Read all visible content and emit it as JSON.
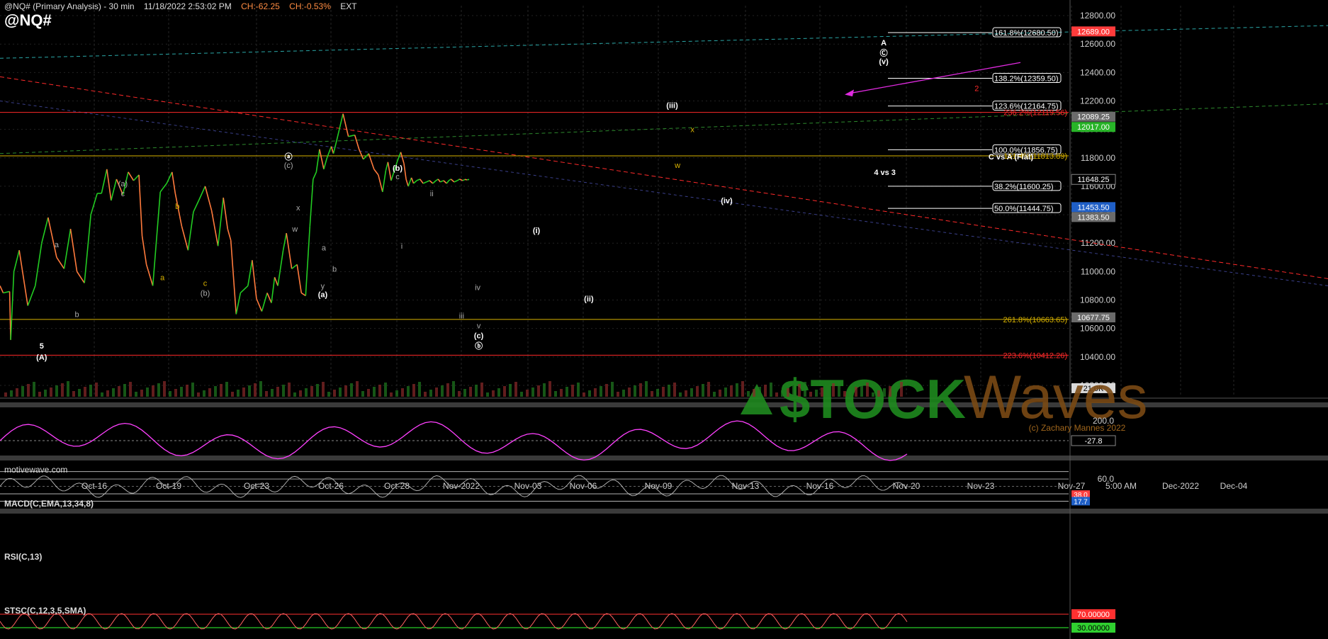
{
  "header": {
    "symbol_line": "@NQ# (Primary Analysis) - 30 min",
    "datetime": "11/18/2022 2:53:02 PM",
    "change": "CH:-62.25",
    "change_pct": "CH:-0.53%",
    "session": "EXT",
    "symbol": "@NQ#"
  },
  "footer": {
    "source": "motivewave.com"
  },
  "colors": {
    "background": "#000000",
    "up": "#22cc22",
    "down": "#ff7a3c",
    "fib_line": "#ffffff",
    "red_line": "#ff2a2a",
    "yellow_line": "#d9b300",
    "teal_line": "#2aa6a6",
    "magenta": "#e02ae0"
  },
  "chart_data": [
    {
      "type": "line",
      "title": "",
      "y_axis": {
        "ticks": [
          "12800.00",
          "12600.00",
          "12400.00",
          "12200.00",
          "12000.00",
          "11800.00",
          "11600.00",
          "11400.00",
          "11200.00",
          "11000.00",
          "10800.00",
          "10600.00",
          "10400.00",
          "10200.00"
        ],
        "ylim": [
          10120,
          12870
        ]
      },
      "x_axis": {
        "ticks": [
          "Oct-16",
          "Oct-19",
          "Oct-23",
          "Oct-26",
          "Oct-28",
          "Nov-2022",
          "Nov-03",
          "Nov-06",
          "Nov-09",
          "Nov-13",
          "Nov-16",
          "Nov-20",
          "Nov-23",
          "Nov-27",
          "5:00 AM",
          "Dec-2022",
          "Dec-04"
        ]
      },
      "price_path": {
        "x": [
          0,
          0.3,
          0.9,
          1.0,
          1.3,
          1.8,
          2.6,
          3.3,
          3.9,
          4.5,
          5.3,
          6.0,
          6.6,
          7.2,
          7.9,
          8.5,
          9.1,
          9.5,
          10.0,
          10.4,
          10.9,
          11.5,
          12.0,
          12.5,
          13.0,
          13.3,
          13.7,
          14.3,
          15.0,
          15.6,
          16.1,
          16.4,
          17.0,
          17.6,
          18.1,
          18.6,
          19.2,
          19.8,
          20.4,
          20.9,
          21.3,
          21.6,
          22.1,
          22.5,
          23.2,
          23.6,
          24.0,
          24.5,
          25.0,
          25.4,
          25.7,
          26.0,
          26.5,
          26.8,
          27.3,
          27.8,
          28.2,
          28.6,
          29.0,
          29.3,
          29.6,
          29.9,
          30.3,
          30.6,
          31.0,
          31.2,
          31.5,
          32.1,
          32.6,
          33.2,
          33.6,
          34.0,
          34.5,
          35.0,
          35.4,
          35.8,
          36.1,
          36.3,
          36.6,
          36.9,
          37.2,
          37.5,
          37.8,
          38.0,
          38.2,
          38.5,
          38.7,
          39.0,
          39.3,
          39.6,
          39.9,
          40.2,
          40.5,
          40.8,
          41.0,
          41.2,
          41.5,
          41.8,
          42.0,
          42.2,
          42.5,
          42.8,
          43.0,
          43.3,
          43.5,
          43.7,
          43.9
        ],
        "y": [
          10900,
          10850,
          10860,
          10520,
          11000,
          11150,
          10760,
          10900,
          11200,
          11380,
          11100,
          11020,
          11300,
          11000,
          10920,
          11400,
          11550,
          11550,
          11720,
          11500,
          11650,
          11540,
          11700,
          11640,
          11680,
          11250,
          11050,
          10900,
          11560,
          11620,
          11700,
          11550,
          11320,
          11150,
          11420,
          11500,
          11600,
          11430,
          11180,
          11520,
          11300,
          11220,
          10700,
          10850,
          10900,
          11080,
          10810,
          10720,
          10850,
          10780,
          10960,
          10900,
          11150,
          11270,
          11020,
          11050,
          10850,
          10830,
          11320,
          11650,
          11700,
          11860,
          11720,
          11800,
          11880,
          11830,
          11920,
          12110,
          11950,
          11960,
          11860,
          11790,
          11830,
          11720,
          11680,
          11560,
          11710,
          11770,
          11640,
          11710,
          11780,
          11840,
          11760,
          11650,
          11600,
          11660,
          11620,
          11640,
          11650,
          11620,
          11630,
          11640,
          11620,
          11640,
          11650,
          11630,
          11640,
          11620,
          11640,
          11650,
          11630,
          11640,
          11650,
          11640,
          11648,
          11645,
          11648
        ]
      },
      "horizontal_levels": [
        {
          "label": "161.8%(12680.50)",
          "value": 12680.5,
          "color": "white"
        },
        {
          "label": "138.2%(12359.50)",
          "value": 12359.5,
          "color": "white"
        },
        {
          "label": "123.6%(12164.75)",
          "value": 12164.75,
          "color": "white"
        },
        {
          "label": "100.0%(11856.75)",
          "value": 11856.75,
          "color": "white"
        },
        {
          "label": "38.2%(11600.25)",
          "value": 11600.25,
          "color": "white"
        },
        {
          "label": "50.0%(11444.75)",
          "value": 11444.75,
          "color": "white"
        },
        {
          "label": "236.2%(12119.56)",
          "value": 12119.56,
          "color": "red"
        },
        {
          "label": "161.4%(11813.89)",
          "value": 11813.89,
          "color": "yellow"
        },
        {
          "label": "261.8%(10663.65)",
          "value": 10663.65,
          "color": "yellow"
        },
        {
          "label": "223.6%(10412.26)",
          "value": 10412.26,
          "color": "red"
        }
      ],
      "price_tags": [
        {
          "label": "12689.00",
          "value": 12689,
          "bg": "#ff3b3b"
        },
        {
          "label": "12089.25",
          "value": 12089.25,
          "bg": "#6b6b6b"
        },
        {
          "label": "12017.00",
          "value": 12017,
          "bg": "#28b428"
        },
        {
          "label": "11648.25",
          "value": 11648.25,
          "bg": "#000000"
        },
        {
          "label": "11453.50",
          "value": 11453.5,
          "bg": "#1f5fc7"
        },
        {
          "label": "11383.50",
          "value": 11383.5,
          "bg": "#6b6b6b"
        },
        {
          "label": "10677.75",
          "value": 10677.75,
          "bg": "#6b6b6b"
        },
        {
          "label": "21.0K",
          "value": 10180,
          "bg": "#d9d9d9"
        }
      ],
      "wave_labels": [
        {
          "t": "(A)",
          "x": 3.9,
          "y": 10380,
          "color": "white"
        },
        {
          "t": "5",
          "x": 3.9,
          "y": 10460,
          "color": "white"
        },
        {
          "t": "a",
          "x": 5.3,
          "y": 11170,
          "color": "#aaaaaa"
        },
        {
          "t": "b",
          "x": 7.2,
          "y": 10680,
          "color": "#aaaaaa"
        },
        {
          "t": "(a)",
          "x": 11.5,
          "y": 11600,
          "color": "#aaaaaa"
        },
        {
          "t": "c",
          "x": 11.5,
          "y": 11530,
          "color": "#aaaaaa"
        },
        {
          "t": "a",
          "x": 15.2,
          "y": 10940,
          "color": "#d9b300"
        },
        {
          "t": "b",
          "x": 16.6,
          "y": 11440,
          "color": "#d9b300"
        },
        {
          "t": "c",
          "x": 19.2,
          "y": 10900,
          "color": "#d9b300"
        },
        {
          "t": "(b)",
          "x": 19.2,
          "y": 10830,
          "color": "#aaaaaa"
        },
        {
          "t": "ⓐ",
          "x": 27.0,
          "y": 11790,
          "color": "white"
        },
        {
          "t": "(c)",
          "x": 27.0,
          "y": 11730,
          "color": "#aaaaaa"
        },
        {
          "t": "x",
          "x": 27.9,
          "y": 11430,
          "color": "#aaaaaa"
        },
        {
          "t": "w",
          "x": 27.6,
          "y": 11280,
          "color": "#aaaaaa"
        },
        {
          "t": "a",
          "x": 30.3,
          "y": 11150,
          "color": "#aaaaaa"
        },
        {
          "t": "y",
          "x": 30.2,
          "y": 10880,
          "color": "#aaaaaa"
        },
        {
          "t": "(a)",
          "x": 30.2,
          "y": 10820,
          "color": "white"
        },
        {
          "t": "b",
          "x": 31.3,
          "y": 11000,
          "color": "#aaaaaa"
        },
        {
          "t": "(b)",
          "x": 37.2,
          "y": 11710,
          "color": "white"
        },
        {
          "t": "c",
          "x": 37.2,
          "y": 11650,
          "color": "#aaaaaa"
        },
        {
          "t": "i",
          "x": 37.6,
          "y": 11160,
          "color": "#aaaaaa"
        },
        {
          "t": "ii",
          "x": 40.4,
          "y": 11530,
          "color": "#aaaaaa"
        },
        {
          "t": "iii",
          "x": 43.2,
          "y": 10670,
          "color": "#aaaaaa"
        },
        {
          "t": "iv",
          "x": 44.7,
          "y": 10870,
          "color": "#aaaaaa"
        },
        {
          "t": "v",
          "x": 44.8,
          "y": 10600,
          "color": "#aaaaaa"
        },
        {
          "t": "(c)",
          "x": 44.8,
          "y": 10530,
          "color": "white"
        },
        {
          "t": "ⓑ",
          "x": 44.8,
          "y": 10460,
          "color": "white"
        },
        {
          "t": "(i)",
          "x": 50.2,
          "y": 11270,
          "color": "white"
        },
        {
          "t": "(ii)",
          "x": 55.1,
          "y": 10790,
          "color": "white"
        },
        {
          "t": "(iii)",
          "x": 62.9,
          "y": 12150,
          "color": "white"
        },
        {
          "t": "x",
          "x": 64.8,
          "y": 11980,
          "color": "#d9b300"
        },
        {
          "t": "w",
          "x": 63.4,
          "y": 11730,
          "color": "#d9b300"
        },
        {
          "t": "(iv)",
          "x": 68.0,
          "y": 11480,
          "color": "white"
        },
        {
          "t": "4 vs 3",
          "x": 82.8,
          "y": 11680,
          "color": "white"
        },
        {
          "t": "C vs A (Flat)",
          "x": 94.6,
          "y": 11790,
          "color": "white"
        },
        {
          "t": "A",
          "x": 82.7,
          "y": 12590,
          "color": "white"
        },
        {
          "t": "Ⓒ",
          "x": 82.7,
          "y": 12520,
          "color": "white"
        },
        {
          "t": "(v)",
          "x": 82.7,
          "y": 12460,
          "color": "white"
        },
        {
          "t": "2",
          "x": 91.4,
          "y": 12270,
          "color": "#ff2a2a"
        }
      ],
      "watermark": {
        "brand_left": "$TOCK",
        "brand_right": "Waves",
        "copyright": "(c) Zachary Mannes 2022"
      }
    },
    {
      "type": "line",
      "title": "MACD(C,EMA,13,34,8)",
      "y_axis": {
        "ticks": [
          "200.0"
        ],
        "ylim": [
          -140,
          230
        ]
      },
      "last_value_tag": "-27.8"
    },
    {
      "type": "line",
      "title": "RSI(C,13)",
      "y_axis": {
        "ticks": [
          "60.0"
        ],
        "ylim": [
          20,
          85
        ]
      },
      "levels": [
        70,
        60,
        50,
        40,
        30
      ],
      "tags": [
        "38.0",
        "17.7"
      ]
    },
    {
      "type": "line",
      "title": "STSC(C,12,3,5,SMA)",
      "y_axis": {
        "ticks": [],
        "ylim": [
          0,
          100
        ]
      },
      "levels": [
        70,
        30
      ],
      "tags": [
        "70.00000",
        "30.00000"
      ]
    }
  ]
}
